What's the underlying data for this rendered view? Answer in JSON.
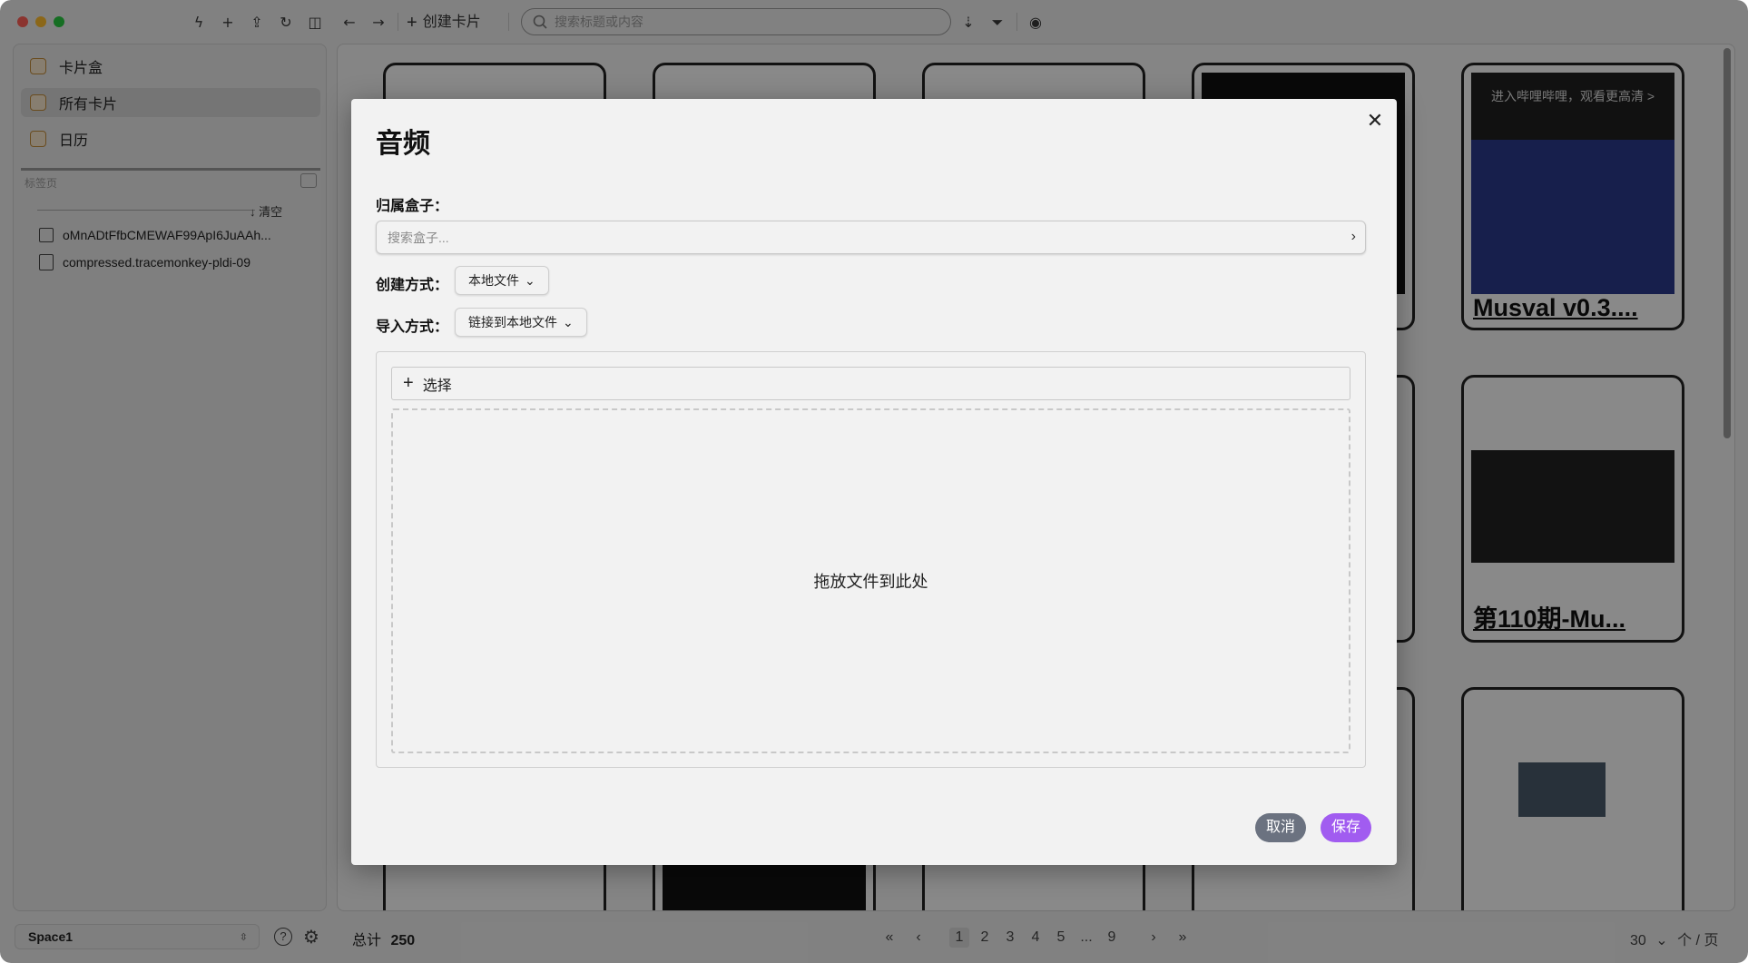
{
  "toolbar": {
    "create_card_label": "创建卡片",
    "search_placeholder": "搜索标题或内容",
    "icons": [
      "flash-icon",
      "plus-icon",
      "import-icon",
      "refresh-icon",
      "sidebar-toggle-icon",
      "back-arrow-icon",
      "forward-arrow-icon",
      "sort-icon",
      "filter-icon",
      "eye-icon"
    ]
  },
  "sidebar": {
    "items": [
      {
        "label": "卡片盒",
        "icon": "card-box-icon"
      },
      {
        "label": "所有卡片",
        "icon": "all-cards-icon"
      },
      {
        "label": "日历",
        "icon": "calendar-icon"
      }
    ],
    "tabs_section_label": "标签页",
    "clear_label": "清空",
    "files": [
      {
        "name": "oMnADtFfbCMEWAF99ApI6JuAAh...",
        "icon": "image-file-icon"
      },
      {
        "name": "compressed.tracemonkey-pldi-09",
        "icon": "pdf-file-icon"
      }
    ],
    "space_name": "Space1"
  },
  "cards": [
    {
      "title": "Musval v0.3....",
      "overlay": "进入哔哩哔哩，观看更高清 >"
    },
    {
      "title": "第110期-Mu..."
    },
    {
      "title": ""
    }
  ],
  "footer": {
    "total_label": "总计",
    "total_count": "250",
    "pages": [
      "1",
      "2",
      "3",
      "4",
      "5",
      "...",
      "9"
    ],
    "current_page": "1",
    "page_size": "30",
    "page_size_unit": "个 / 页"
  },
  "modal": {
    "title": "音频",
    "box_label": "归属盒子：",
    "box_placeholder": "搜索盒子...",
    "create_mode_label": "创建方式：",
    "create_mode_value": "本地文件",
    "import_mode_label": "导入方式：",
    "import_mode_value": "链接到本地文件",
    "select_label": "选择",
    "dropzone_text": "拖放文件到此处",
    "cancel_label": "取消",
    "save_label": "保存"
  },
  "colors": {
    "accent": "#a15cf0",
    "cancel_bg": "#6b7280"
  }
}
